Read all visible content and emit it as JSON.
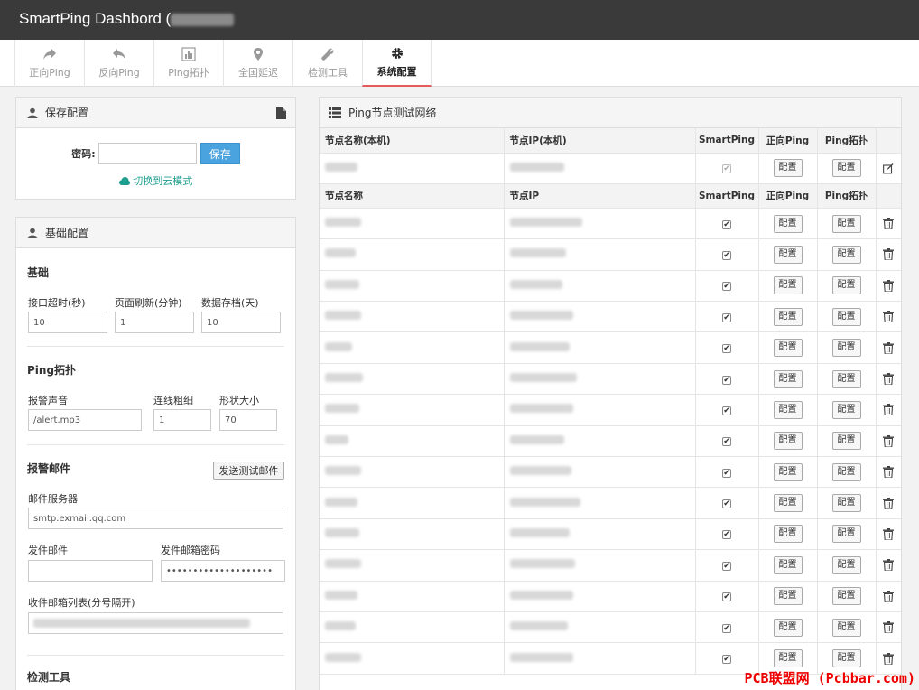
{
  "app": {
    "title": "SmartPing Dashbord ("
  },
  "nav": {
    "tabs": [
      {
        "label": "正向Ping",
        "icon": "share-icon"
      },
      {
        "label": "反向Ping",
        "icon": "reply-icon"
      },
      {
        "label": "Ping拓扑",
        "icon": "bar-chart-icon"
      },
      {
        "label": "全国延迟",
        "icon": "map-pin-icon"
      },
      {
        "label": "检测工具",
        "icon": "wrench-icon"
      },
      {
        "label": "系统配置",
        "icon": "gear-icon"
      }
    ]
  },
  "save_panel": {
    "title": "保存配置",
    "password_label": "密码:",
    "password_value": "",
    "save_button": "保存",
    "cloud_link": "切换到云模式"
  },
  "basic_panel": {
    "title": "基础配置",
    "basic": {
      "title": "基础",
      "timeout_label": "接口超时(秒)",
      "timeout_value": "10",
      "refresh_label": "页面刷新(分钟)",
      "refresh_value": "1",
      "archive_label": "数据存档(天)",
      "archive_value": "10"
    },
    "topo": {
      "title": "Ping拓扑",
      "sound_label": "报警声音",
      "sound_value": "/alert.mp3",
      "line_label": "连线粗细",
      "line_value": "1",
      "shape_label": "形状大小",
      "shape_value": "70"
    },
    "mail": {
      "title": "报警邮件",
      "test_button": "发送测试邮件",
      "server_label": "邮件服务器",
      "server_value": "smtp.exmail.qq.com",
      "sender_label": "发件邮件",
      "sender_value": "",
      "sender_pw_label": "发件邮箱密码",
      "sender_pw_value": "••••••••••••••••••••",
      "recv_label": "收件邮箱列表(分号隔开)"
    },
    "tools_title": "检测工具"
  },
  "nodes_panel": {
    "title": "Ping节点测试网络",
    "local_headers": [
      "节点名称(本机)",
      "节点IP(本机)",
      "SmartPing",
      "正向Ping",
      "Ping拓扑",
      ""
    ],
    "headers": [
      "节点名称",
      "节点IP",
      "SmartPing",
      "正向Ping",
      "Ping拓扑",
      ""
    ],
    "config_label": "配置",
    "check_mark": "✔",
    "row_count": 15
  },
  "watermark": "PCB联盟网 (Pcbbar.com)"
}
